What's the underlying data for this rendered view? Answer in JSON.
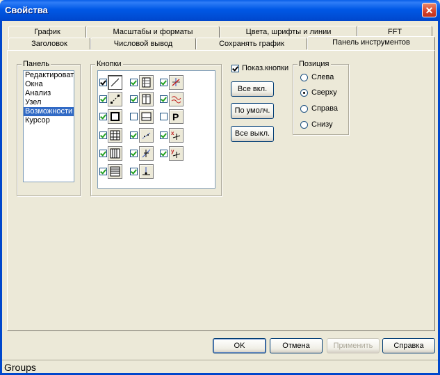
{
  "window": {
    "title": "Свойства",
    "close_glyph": "✕"
  },
  "tabs": {
    "row1": [
      "График",
      "Масштабы и форматы",
      "Цвета, шрифты и линии",
      "FFT"
    ],
    "row2": [
      "Заголовок",
      "Числовой вывод",
      "Сохранять график",
      "Панель инструментов"
    ],
    "active": "Панель инструментов"
  },
  "panel_group": {
    "label": "Панель",
    "items": [
      "Редактировать",
      "Окна",
      "Анализ",
      "Узел",
      "Возможности",
      "Курсор"
    ],
    "selected": "Возможности"
  },
  "buttons_group": {
    "label": "Кнопки",
    "rows": [
      [
        {
          "checked": true,
          "icon": "line-tool-icon"
        },
        {
          "checked": true,
          "icon": "table-grid-icon"
        },
        {
          "checked": true,
          "icon": "node-cross-icon"
        }
      ],
      [
        {
          "checked": true,
          "icon": "dotted-line-icon"
        },
        {
          "checked": true,
          "icon": "table-columns-icon"
        },
        {
          "checked": true,
          "icon": "wave-lines-icon"
        }
      ],
      [
        {
          "checked": true,
          "icon": "frame-box-icon"
        },
        {
          "checked": false,
          "icon": "box-with-bar-icon"
        },
        {
          "checked": false,
          "icon": "p-label-icon"
        }
      ],
      [
        {
          "checked": true,
          "icon": "grid-icon"
        },
        {
          "checked": true,
          "icon": "trend-line-icon"
        },
        {
          "checked": true,
          "icon": "x-balance-icon"
        }
      ],
      [
        {
          "checked": true,
          "icon": "vertical-bars-icon"
        },
        {
          "checked": true,
          "icon": "cursor-cross-icon"
        },
        {
          "checked": true,
          "icon": "y-balance-icon"
        }
      ],
      [
        {
          "checked": true,
          "icon": "horizontal-bars-icon"
        },
        {
          "checked": true,
          "icon": "axis-cursor-icon"
        }
      ]
    ]
  },
  "show_buttons": {
    "label": "Показ.кнопки",
    "checked": true
  },
  "side_buttons": {
    "all_on": "Все вкл.",
    "default": "По умолч.",
    "all_off": "Все выкл."
  },
  "position_group": {
    "label": "Позиция",
    "options": [
      "Слева",
      "Сверху",
      "Справа",
      "Снизу"
    ],
    "selected": "Сверху"
  },
  "footer_buttons": {
    "ok": "OK",
    "cancel": "Отмена",
    "apply": "Применить",
    "help": "Справка"
  },
  "status": {
    "text": "Groups"
  }
}
